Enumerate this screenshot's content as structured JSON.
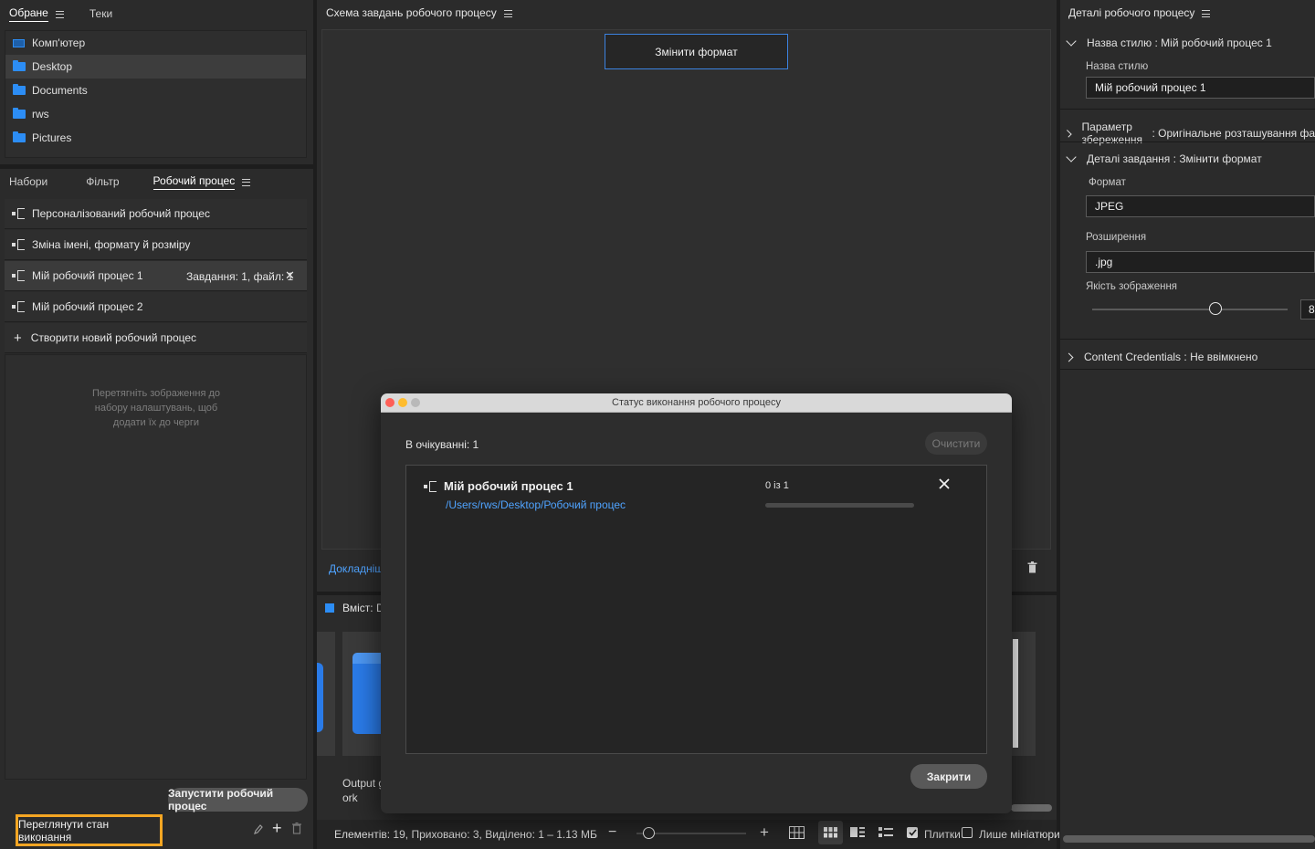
{
  "favorites": {
    "tabs": [
      "Обране",
      "Теки"
    ],
    "items": [
      {
        "label": "Комп'ютер",
        "icon": "computer-icon",
        "selected": false
      },
      {
        "label": "Desktop",
        "icon": "folder-icon",
        "selected": true
      },
      {
        "label": "Documents",
        "icon": "folder-icon",
        "selected": false
      },
      {
        "label": "rws",
        "icon": "folder-icon",
        "selected": false
      },
      {
        "label": "Pictures",
        "icon": "folder-icon",
        "selected": false
      }
    ]
  },
  "workflow_panel": {
    "tabs": [
      "Набори",
      "Фільтр",
      "Робочий процес"
    ],
    "items": [
      {
        "label": "Персоналізований робочий процес"
      },
      {
        "label": "Зміна імені, формату й розміру"
      },
      {
        "label": "Мій робочий процес 1",
        "status": "Завдання: 1, файл: 1",
        "close": "✕"
      },
      {
        "label": "Мій робочий процес 2"
      },
      {
        "label": "Створити новий робочий процес",
        "icon": "+"
      }
    ],
    "drop_hint": "Перетягніть зображення до набору налаштувань, щоб додати їх до черги",
    "run_button": "Запустити робочий процес",
    "view_status_button": "Переглянути стан виконання"
  },
  "schema_panel": {
    "title": "Схема завдань робочого процесу",
    "task_node": "Змінити формат",
    "learn_more": "Докладніше",
    "content_label": "Вміст: De",
    "output_label_line1": "Output g",
    "output_label_line2": "ork"
  },
  "status_bar": {
    "text": "Елементів: 19, Приховано: 3, Виділено: 1 – 1.13 МБ",
    "zoom_level": 0.1,
    "tiles_label": "Плитки",
    "tiles_checked": true,
    "thumbs_only_label": "Лише мініатюри",
    "thumbs_only_checked": false
  },
  "details_panel": {
    "title": "Деталі робочого процесу",
    "style_section": {
      "head_key": "Назва стилю",
      "head_value": "Мій робочий процес 1",
      "field_label": "Назва стилю",
      "field_value": "Мій робочий процес 1"
    },
    "save_section": {
      "head_key": "Параметр збереження",
      "head_value": "Оригінальне розташування фа"
    },
    "task_section": {
      "head_key": "Деталі завдання",
      "head_value": "Змінити формат",
      "format_label": "Формат",
      "format_value": "JPEG",
      "ext_label": "Розширення",
      "ext_value": ".jpg",
      "quality_label": "Якість зображення",
      "quality_fraction": 0.63,
      "quality_value": "8"
    },
    "cc_section": {
      "head_key": "Content Credentials",
      "head_value": "Не ввімкнено"
    }
  },
  "dialog": {
    "title": "Статус виконання робочого процесу",
    "pending": "В очікуванні: 1",
    "clear_button": "Очистити",
    "job_name": "Мій робочий процес 1",
    "job_path": "/Users/rws/Desktop/Робочий процес",
    "progress_text": "0 із 1",
    "progress_fraction": 0,
    "close_button": "Закрити"
  },
  "colors": {
    "accent_blue": "#2c8df5",
    "link_blue": "#4fa3ff",
    "highlight_orange": "#f5a623"
  }
}
